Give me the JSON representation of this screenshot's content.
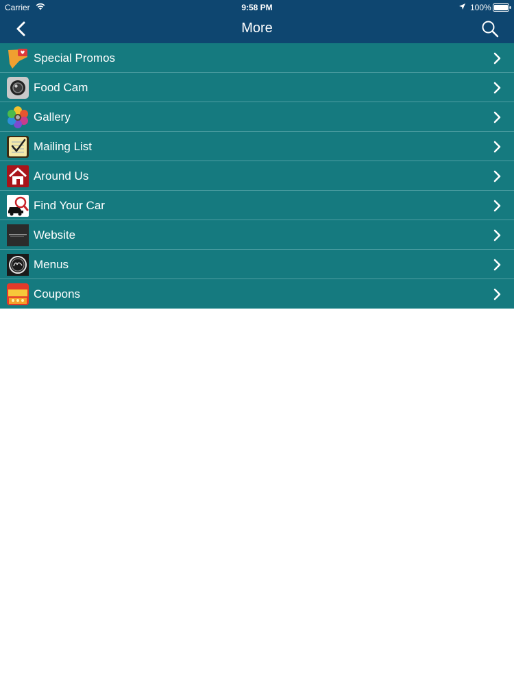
{
  "status_bar": {
    "carrier": "Carrier",
    "time": "9:58 PM",
    "battery": "100%"
  },
  "nav": {
    "title": "More",
    "back_icon": "chevron-left-icon",
    "search_icon": "search-icon"
  },
  "colors": {
    "nav_background": "#0e4670",
    "row_background": "#157a7f",
    "row_divider": "#4f9fa3"
  },
  "menu_items": [
    {
      "label": "Special Promos",
      "icon": "promo-icon"
    },
    {
      "label": "Food Cam",
      "icon": "camera-icon"
    },
    {
      "label": "Gallery",
      "icon": "gallery-icon"
    },
    {
      "label": "Mailing List",
      "icon": "mailing-list-icon"
    },
    {
      "label": "Around Us",
      "icon": "home-icon"
    },
    {
      "label": "Find Your Car",
      "icon": "find-car-icon"
    },
    {
      "label": "Website",
      "icon": "website-icon"
    },
    {
      "label": "Menus",
      "icon": "menus-icon"
    },
    {
      "label": "Coupons",
      "icon": "coupon-icon"
    }
  ]
}
